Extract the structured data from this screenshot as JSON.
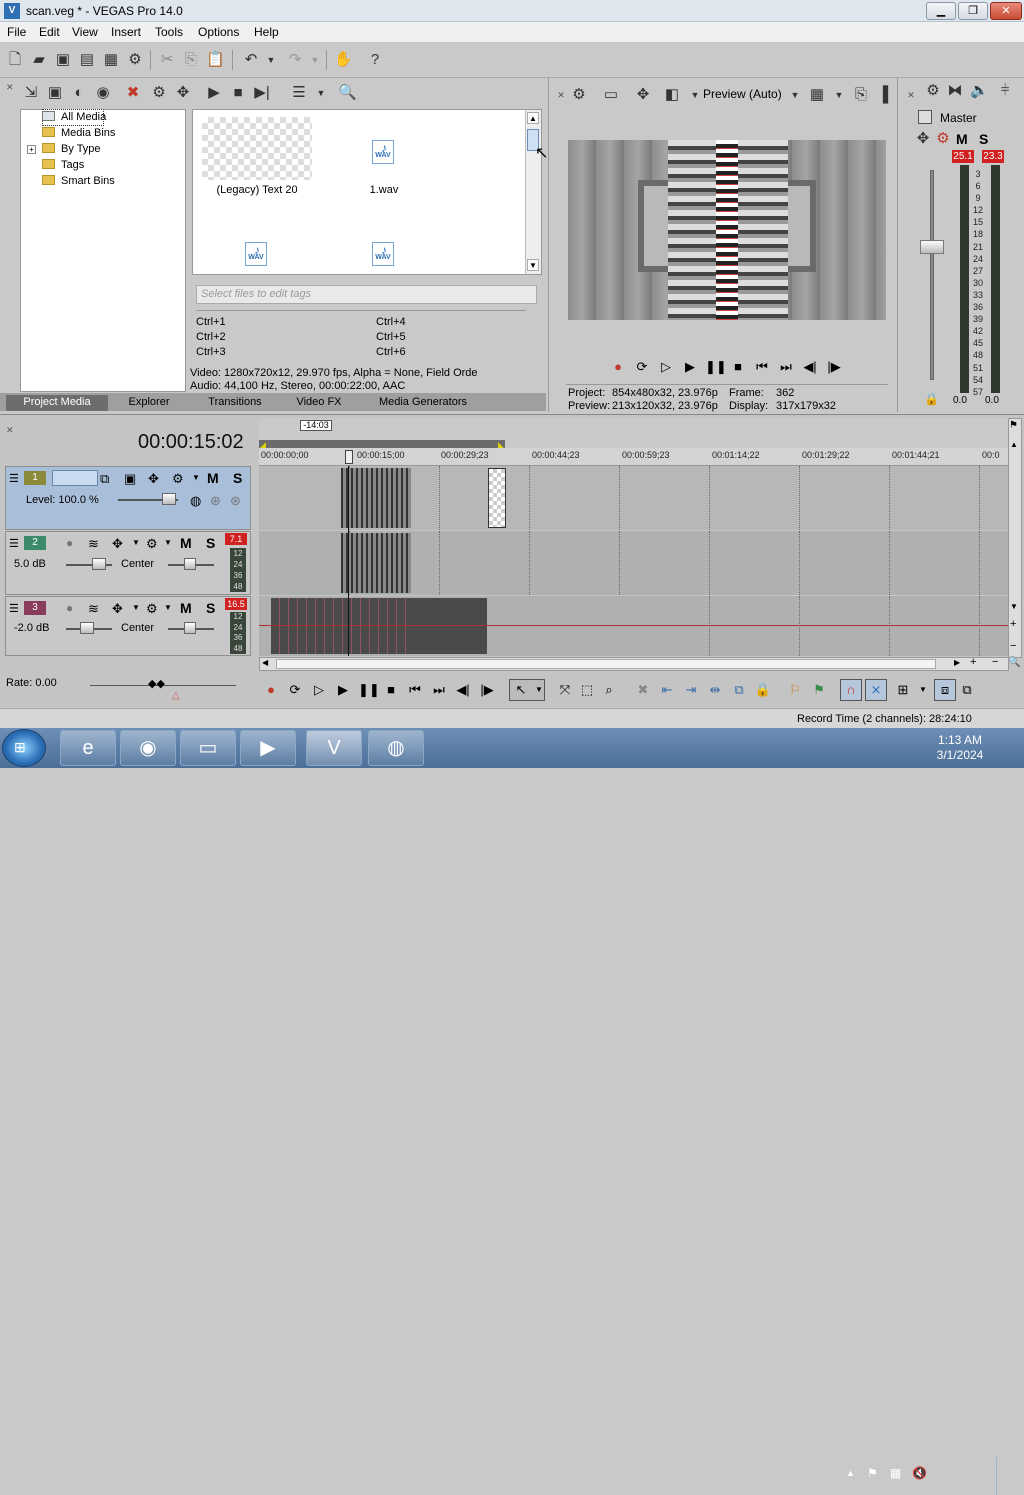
{
  "window": {
    "title": "scan.veg * - VEGAS Pro 14.0",
    "minimize": "▁",
    "maximize": "❐",
    "close": "✕"
  },
  "menu": [
    "File",
    "Edit",
    "View",
    "Insert",
    "Tools",
    "Options",
    "Help"
  ],
  "project_media": {
    "tree": [
      "All Media",
      "Media Bins",
      "By Type",
      "Tags",
      "Smart Bins"
    ],
    "expand_marker": "+",
    "items": [
      {
        "label": "(Legacy) Text 20"
      },
      {
        "label": "1.wav"
      },
      {
        "label": ""
      },
      {
        "label": ""
      }
    ],
    "wav_badge": "WAV",
    "tag_placeholder": "Select files to edit tags",
    "shortcuts_left": [
      "Ctrl+1",
      "Ctrl+2",
      "Ctrl+3"
    ],
    "shortcuts_right": [
      "Ctrl+4",
      "Ctrl+5",
      "Ctrl+6"
    ],
    "info_video": "Video: 1280x720x12, 29.970 fps, Alpha = None, Field Orde",
    "info_audio": "Audio: 44,100 Hz, Stereo, 00:00:22:00, AAC"
  },
  "tabs": [
    "Project Media",
    "Explorer",
    "Transitions",
    "Video FX",
    "Media Generators"
  ],
  "preview": {
    "mode": "Preview (Auto)",
    "project_label": "Project:",
    "project_value": "854x480x32, 23.976p",
    "preview_label": "Preview:",
    "preview_value": "213x120x32, 23.976p",
    "frame_label": "Frame:",
    "frame_value": "362",
    "display_label": "Display:",
    "display_value": "317x179x32"
  },
  "master": {
    "label": "Master",
    "m_label": "M",
    "s_label": "S",
    "peak_left": "25.1",
    "peak_right": "23.3",
    "scale": [
      "3",
      "6",
      "9",
      "12",
      "15",
      "18",
      "21",
      "24",
      "27",
      "30",
      "33",
      "36",
      "39",
      "42",
      "45",
      "48",
      "51",
      "54",
      "57"
    ],
    "bottom_left": "0.0",
    "bottom_right": "0.0"
  },
  "timeline": {
    "timecode": "00:00:15:02",
    "cursor_marker": "-14:03",
    "ruler": [
      "00:00:00;00",
      "00:00:15;00",
      "00:00:29;23",
      "00:00:44;23",
      "00:00:59;23",
      "00:01:14;22",
      "00:01:29;22",
      "00:01:44;21",
      "00:0"
    ],
    "tracks": [
      {
        "num": "1",
        "level_label": "Level: 100.0 %",
        "m": "M",
        "s": "S"
      },
      {
        "num": "2",
        "volume": "5.0 dB",
        "pan": "Center",
        "peak": "7.1",
        "m": "M",
        "s": "S"
      },
      {
        "num": "3",
        "volume": "-2.0 dB",
        "pan": "Center",
        "peak": "16.5",
        "m": "M",
        "s": "S"
      }
    ],
    "track_scale": [
      "12",
      "24",
      "36",
      "48"
    ],
    "rate": "Rate: 0.00"
  },
  "status": {
    "record_time": "Record Time (2 channels): 28:24:10"
  },
  "taskbar": {
    "time": "1:13 AM",
    "date": "3/1/2024"
  },
  "colors": {
    "track1": "#8a8a3a",
    "track2": "#3d8a6a",
    "track3": "#8a3d5a",
    "selected_track": "#a9bfd9",
    "peak": "#d12020"
  }
}
